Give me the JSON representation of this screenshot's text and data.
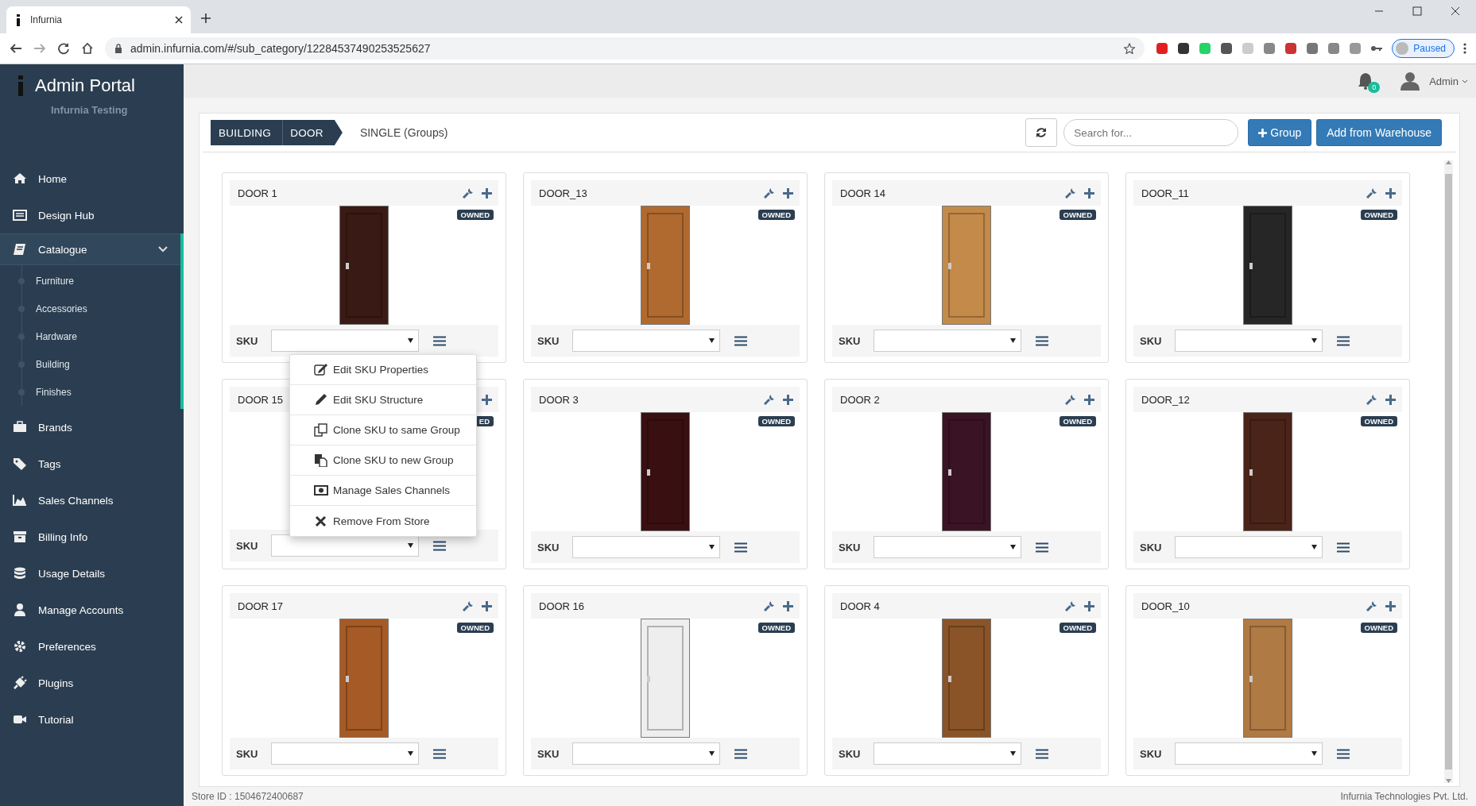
{
  "browser": {
    "tab_title": "Infurnia",
    "url": "admin.infurnia.com/#/sub_category/12284537490253525627",
    "profile_status": "Paused"
  },
  "sidebar": {
    "title": "Admin Portal",
    "subtitle": "Infurnia Testing",
    "items": [
      {
        "label": "Home",
        "selected": false
      },
      {
        "label": "Design Hub",
        "selected": false
      },
      {
        "label": "Catalogue",
        "selected": true,
        "expanded": true,
        "children": [
          {
            "label": "Furniture"
          },
          {
            "label": "Accessories"
          },
          {
            "label": "Hardware"
          },
          {
            "label": "Building"
          },
          {
            "label": "Finishes"
          }
        ]
      },
      {
        "label": "Brands",
        "selected": false
      },
      {
        "label": "Tags",
        "selected": false
      },
      {
        "label": "Sales Channels",
        "selected": false
      },
      {
        "label": "Billing Info",
        "selected": false
      },
      {
        "label": "Usage Details",
        "selected": false
      },
      {
        "label": "Manage Accounts",
        "selected": false
      },
      {
        "label": "Preferences",
        "selected": false
      },
      {
        "label": "Plugins",
        "selected": false
      },
      {
        "label": "Tutorial",
        "selected": false
      }
    ]
  },
  "header": {
    "notification_count": "0",
    "user": "Admin"
  },
  "toolbar": {
    "breadcrumb": [
      "BUILDING",
      "DOOR"
    ],
    "current": "SINGLE (Groups)",
    "search": {
      "placeholder": "Search for..."
    },
    "buttons": [
      "Group",
      "Add from Warehouse"
    ]
  },
  "cards": [
    {
      "title": "DOOR 1",
      "badge": "OWNED",
      "color": "#3a1a14",
      "sku_label": "SKU"
    },
    {
      "title": "DOOR_13",
      "badge": "OWNED",
      "color": "#b06a30",
      "sku_label": "SKU"
    },
    {
      "title": "DOOR 14",
      "badge": "OWNED",
      "color": "#c48a4a",
      "sku_label": "SKU"
    },
    {
      "title": "DOOR_11",
      "badge": "OWNED",
      "color": "#262626",
      "sku_label": "SKU"
    },
    {
      "title": "DOOR 15",
      "badge": "ED",
      "sku_label": "SKU"
    },
    {
      "title": "DOOR 3",
      "badge": "OWNED",
      "color": "#3a0f12",
      "sku_label": "SKU"
    },
    {
      "title": "DOOR 2",
      "badge": "OWNED",
      "color": "#3a1424",
      "sku_label": "SKU"
    },
    {
      "title": "DOOR_12",
      "badge": "OWNED",
      "color": "#4a2418",
      "sku_label": "SKU"
    },
    {
      "title": "DOOR 17",
      "badge": "OWNED",
      "color": "#a65a25",
      "sku_label": "SKU"
    },
    {
      "title": "DOOR 16",
      "badge": "OWNED",
      "color": "#eeeeee",
      "sku_label": "SKU"
    },
    {
      "title": "DOOR 4",
      "badge": "OWNED",
      "color": "#8a5428",
      "sku_label": "SKU"
    },
    {
      "title": "DOOR_10",
      "badge": "OWNED",
      "color": "#b07a45",
      "sku_label": "SKU"
    }
  ],
  "context_menu": {
    "items": [
      "Edit SKU Properties",
      "Edit SKU Structure",
      "Clone SKU to same Group",
      "Clone SKU to new Group",
      "Manage Sales Channels",
      "Remove From Store"
    ]
  },
  "footer": {
    "store_id": "Store ID : 1504672400687",
    "company": "Infurnia Technologies Pvt. Ltd."
  }
}
